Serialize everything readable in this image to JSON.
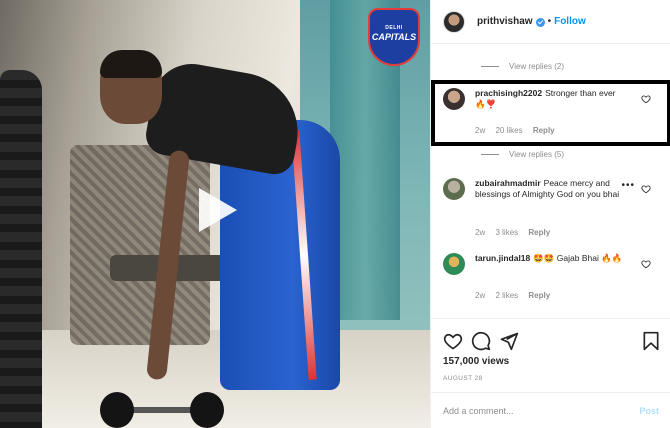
{
  "media": {
    "logo": {
      "line1": "DELHI",
      "line2": "CAPITALS"
    },
    "play_icon": "play-icon"
  },
  "header": {
    "username": "prithvishaw",
    "separator": "•",
    "follow_label": "Follow",
    "verified_icon": "verified-badge-icon"
  },
  "comments": {
    "view_replies_1": "View replies (2)",
    "view_replies_2": "View replies (5)",
    "items": [
      {
        "username": "prachisingh2202",
        "text": "Stronger than ever🔥❣️",
        "age": "2w",
        "likes": "20 likes",
        "reply": "Reply",
        "highlighted": true
      },
      {
        "username": "zubairahmadmir",
        "text": "Peace mercy and blessings of Almighty God on you bhai",
        "age": "2w",
        "likes": "3 likes",
        "reply": "Reply",
        "more": "•••"
      },
      {
        "username": "tarun.jindal18",
        "text": "🤩🤩 Gajab Bhai 🔥🔥",
        "age": "2w",
        "likes": "2 likes",
        "reply": "Reply"
      }
    ]
  },
  "actions": {
    "icons": [
      "heart-icon",
      "comment-icon",
      "share-icon",
      "bookmark-icon"
    ],
    "views": "157,000 views",
    "date": "AUGUST 28"
  },
  "add_comment": {
    "placeholder": "Add a comment...",
    "post_label": "Post"
  },
  "colors": {
    "link_blue": "#0095f6",
    "post_disabled": "#b2dffc",
    "muted_text": "#8e8e8e",
    "highlight_border": "#000000"
  }
}
